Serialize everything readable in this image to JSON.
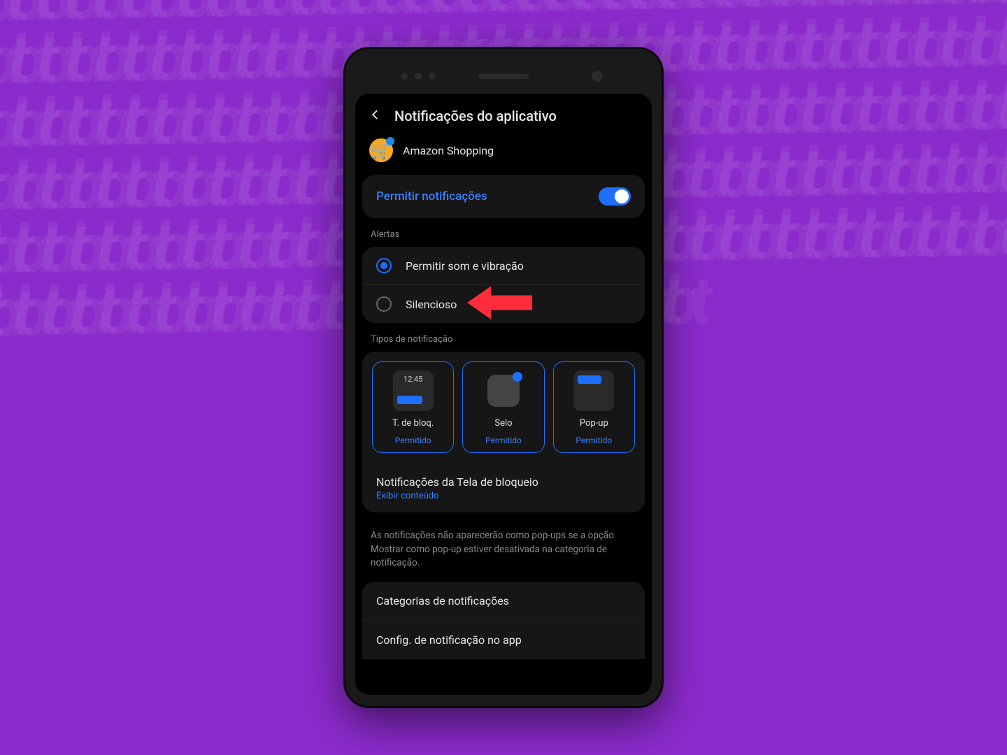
{
  "header": {
    "title": "Notificações do aplicativo"
  },
  "app": {
    "name": "Amazon Shopping"
  },
  "permission": {
    "label": "Permitir notificações"
  },
  "alerts": {
    "section": "Alertas",
    "options": [
      {
        "label": "Permitir som e vibração"
      },
      {
        "label": "Silencioso"
      }
    ]
  },
  "types": {
    "section": "Tipos de notificação",
    "preview_clock": "12:45",
    "cards": [
      {
        "label": "T. de bloq.",
        "status": "Permitido"
      },
      {
        "label": "Selo",
        "status": "Permitido"
      },
      {
        "label": "Pop-up",
        "status": "Permitido"
      }
    ]
  },
  "lockscreen": {
    "title": "Notificações da Tela de bloqueio",
    "subtitle": "Exibir conteúdo"
  },
  "help": "As notificações não aparecerão como pop-ups se a opção Mostrar como pop-up estiver desativada na categoria de notificação.",
  "menu": {
    "categories": "Categorias de notificações",
    "config": "Config. de notificação no app"
  },
  "colors": {
    "accent": "#1f6fff",
    "link": "#3a82ff",
    "background_page": "#8b2bcb"
  }
}
